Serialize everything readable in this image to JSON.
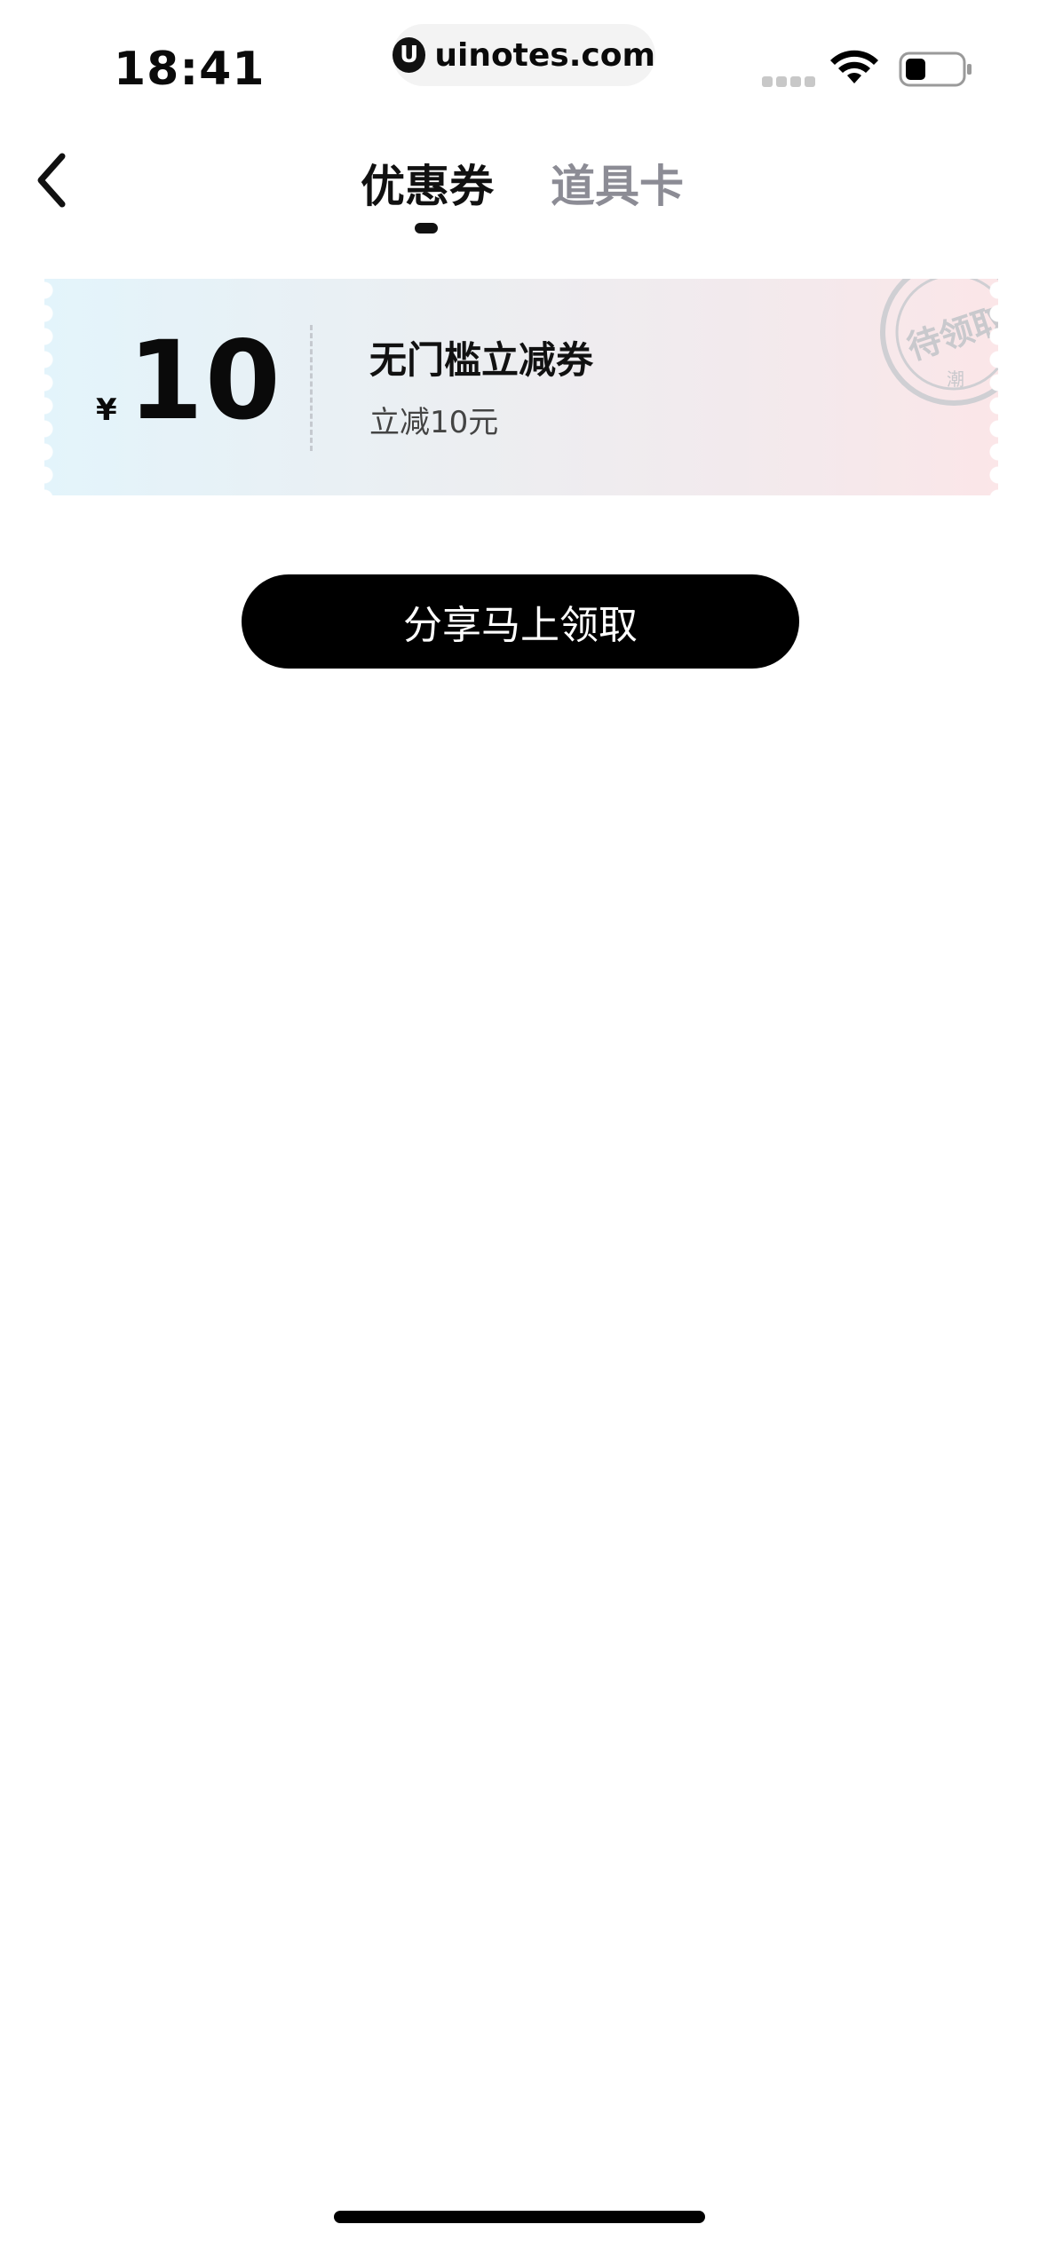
{
  "status_bar": {
    "time": "18:41",
    "url": "uinotes.com",
    "url_logo_letter": "U",
    "icons": [
      "signal-icon",
      "wifi-icon",
      "battery-icon"
    ]
  },
  "nav": {
    "back_icon": "chevron-left-icon",
    "tabs": [
      {
        "label": "优惠券",
        "active": true
      },
      {
        "label": "道具卡",
        "active": false
      }
    ]
  },
  "coupon": {
    "currency": "¥",
    "amount": "10",
    "title": "无门槛立减券",
    "description": "立减10元",
    "stamp_text": "待领取",
    "stamp_subtext": "潮"
  },
  "share_button": {
    "label": "分享马上领取"
  },
  "colors": {
    "accent": "#000000",
    "inactive_tab": "#8c8c95",
    "coupon_gradient_start": "#e3f4fb",
    "coupon_gradient_end": "#fbe6e8"
  }
}
